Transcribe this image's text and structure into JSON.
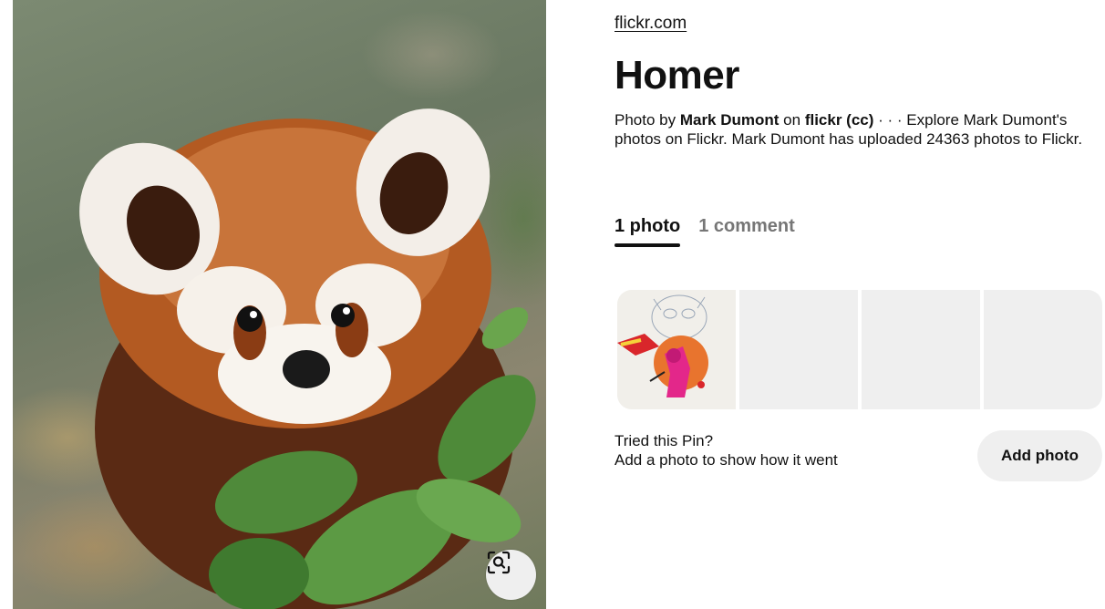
{
  "pin": {
    "source_link": "flickr.com",
    "title": "Homer",
    "description": {
      "prefix": "Photo by ",
      "author": "Mark Dumont",
      "on": " on ",
      "site": "flickr (cc)",
      "rest": " · · · Explore Mark Dumont's photos on Flickr. Mark Dumont has uploaded 24363 photos to Flickr."
    },
    "image_subject": "red panda"
  },
  "tabs": [
    {
      "label": "1 photo",
      "active": true
    },
    {
      "label": "1 comment",
      "active": false
    }
  ],
  "tries": {
    "slots": 4,
    "filled": 1
  },
  "tried": {
    "question": "Tried this Pin?",
    "prompt": "Add a photo to show how it went",
    "button_label": "Add photo"
  },
  "icons": {
    "visual_search": "visual-search-icon"
  },
  "colors": {
    "text": "#111111",
    "muted": "#767676",
    "button_bg": "#efefef"
  }
}
